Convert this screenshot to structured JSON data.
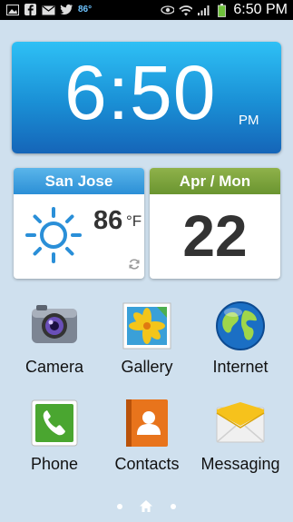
{
  "status_bar": {
    "left_icons": [
      "gallery-icon",
      "facebook-icon",
      "email-icon",
      "twitter-icon"
    ],
    "weather_temp": "86°",
    "right_icons": [
      "eye-icon",
      "wifi-icon",
      "signal-icon",
      "battery-icon"
    ],
    "time": "6:50 PM"
  },
  "clock": {
    "time": "6:50",
    "ampm": "PM"
  },
  "weather": {
    "city": "San Jose",
    "temperature": "86",
    "unit": "°F",
    "icon": "sun-icon"
  },
  "date": {
    "header": "Apr / Mon",
    "day": "22"
  },
  "apps": [
    {
      "label": "Camera",
      "icon": "camera-icon"
    },
    {
      "label": "Gallery",
      "icon": "gallery-icon"
    },
    {
      "label": "Internet",
      "icon": "globe-icon"
    },
    {
      "label": "Phone",
      "icon": "phone-icon"
    },
    {
      "label": "Contacts",
      "icon": "contacts-icon"
    },
    {
      "label": "Messaging",
      "icon": "messaging-icon"
    }
  ],
  "page_indicator": {
    "pages": 3,
    "current": 2
  },
  "colors": {
    "wallpaper": "#cfe0ee",
    "clock_top": "#2ec0f5",
    "clock_bottom": "#1565b8",
    "weather_header": "#3a9fe0",
    "date_header": "#7aa23c"
  }
}
